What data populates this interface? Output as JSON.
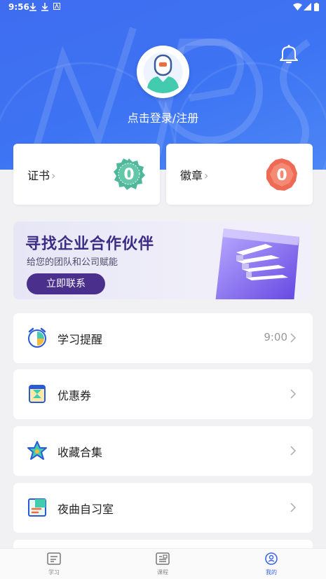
{
  "status_bar": {
    "time": "9:56"
  },
  "header": {
    "login_text": "点击登录/注册"
  },
  "stats": [
    {
      "label": "证书",
      "count": "0",
      "color": "#4fb89a"
    },
    {
      "label": "徽章",
      "count": "0",
      "color": "#ef6a55"
    }
  ],
  "banner": {
    "title": "寻找企业合作伙伴",
    "subtitle": "给您的团队和公司赋能",
    "button": "立即联系"
  },
  "menu": [
    {
      "label": "学习提醒",
      "value": "9:00",
      "icon": "alarm-clock-icon"
    },
    {
      "label": "优惠券",
      "value": "",
      "icon": "coupon-icon"
    },
    {
      "label": "收藏合集",
      "value": "",
      "icon": "star-icon"
    },
    {
      "label": "夜曲自习室",
      "value": "",
      "icon": "study-room-icon"
    }
  ],
  "tabs": [
    {
      "label": "学习",
      "icon": "study-icon",
      "active": false
    },
    {
      "label": "课程",
      "icon": "course-icon",
      "active": false
    },
    {
      "label": "我的",
      "icon": "profile-icon",
      "active": true
    }
  ],
  "colors": {
    "brand": "#3f6cf0",
    "accent": "#4a2f8c",
    "active_tab": "#3a64e8"
  }
}
